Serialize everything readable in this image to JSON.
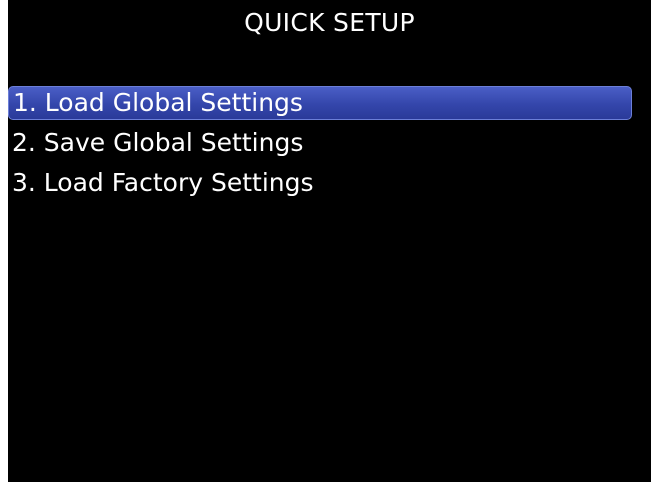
{
  "screen": {
    "title": "QUICK SETUP",
    "menu": {
      "items": [
        {
          "label": "1. Load Global Settings",
          "selected": true
        },
        {
          "label": "2. Save Global Settings",
          "selected": false
        },
        {
          "label": "3. Load Factory Settings",
          "selected": false
        }
      ]
    }
  },
  "colors": {
    "background": "#000000",
    "text": "#ffffff",
    "selection_highlight": "#3446ab"
  }
}
